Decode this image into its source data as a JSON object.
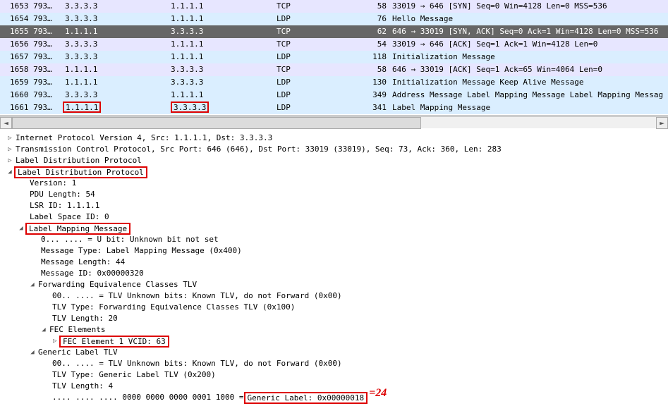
{
  "packets": [
    {
      "no": "1653",
      "time": "793…",
      "src": "3.3.3.3",
      "dst": "1.1.1.1",
      "proto": "TCP",
      "len": "58",
      "info": "33019 → 646 [SYN] Seq=0 Win=4128 Len=0 MSS=536",
      "cls": "tcp"
    },
    {
      "no": "1654",
      "time": "793…",
      "src": "3.3.3.3",
      "dst": "1.1.1.1",
      "proto": "LDP",
      "len": "76",
      "info": "Hello Message",
      "cls": "ldp"
    },
    {
      "no": "1655",
      "time": "793…",
      "src": "1.1.1.1",
      "dst": "3.3.3.3",
      "proto": "TCP",
      "len": "62",
      "info": "646 → 33019 [SYN, ACK] Seq=0 Ack=1 Win=4128 Len=0 MSS=536",
      "cls": "selected"
    },
    {
      "no": "1656",
      "time": "793…",
      "src": "3.3.3.3",
      "dst": "1.1.1.1",
      "proto": "TCP",
      "len": "54",
      "info": "33019 → 646 [ACK] Seq=1 Ack=1 Win=4128 Len=0",
      "cls": "tcp"
    },
    {
      "no": "1657",
      "time": "793…",
      "src": "3.3.3.3",
      "dst": "1.1.1.1",
      "proto": "LDP",
      "len": "118",
      "info": "Initialization Message",
      "cls": "ldp"
    },
    {
      "no": "1658",
      "time": "793…",
      "src": "1.1.1.1",
      "dst": "3.3.3.3",
      "proto": "TCP",
      "len": "58",
      "info": "646 → 33019 [ACK] Seq=1 Ack=65 Win=4064 Len=0",
      "cls": "tcp"
    },
    {
      "no": "1659",
      "time": "793…",
      "src": "1.1.1.1",
      "dst": "3.3.3.3",
      "proto": "LDP",
      "len": "130",
      "info": "Initialization Message Keep Alive Message",
      "cls": "ldp"
    },
    {
      "no": "1660",
      "time": "793…",
      "src": "3.3.3.3",
      "dst": "1.1.1.1",
      "proto": "LDP",
      "len": "349",
      "info": "Address Message Label Mapping Message Label Mapping Messag",
      "cls": "ldp"
    },
    {
      "no": "1661",
      "time": "793…",
      "src": "1.1.1.1",
      "dst": "3.3.3.3",
      "proto": "LDP",
      "len": "341",
      "info": "Label Mapping Message",
      "cls": "ldp",
      "hl_addr": true
    }
  ],
  "details": {
    "ip": "Internet Protocol Version 4, Src: 1.1.1.1, Dst: 3.3.3.3",
    "tcp": "Transmission Control Protocol, Src Port: 646 (646), Dst Port: 33019 (33019), Seq: 73, Ack: 360, Len: 283",
    "ldp1": "Label Distribution Protocol",
    "ldp2": "Label Distribution Protocol",
    "version": "Version: 1",
    "pdu_len": "PDU Length: 54",
    "lsr_id": "LSR ID: 1.1.1.1",
    "label_space": "Label Space ID: 0",
    "lmm": "Label Mapping Message",
    "ubit": "0... .... = U bit: Unknown bit not set",
    "msg_type": "Message Type: Label Mapping Message (0x400)",
    "msg_len": "Message Length: 44",
    "msg_id": "Message ID: 0x00000320",
    "fec_tlv": "Forwarding Equivalence Classes TLV",
    "fec_unknown": "00.. .... = TLV Unknown bits: Known TLV, do not Forward (0x00)",
    "fec_type": "TLV Type: Forwarding Equivalence Classes TLV (0x100)",
    "fec_len": "TLV Length: 20",
    "fec_elems": "FEC Elements",
    "fec_elem1": "FEC Element 1 VCID: 63",
    "gen_tlv": "Generic Label TLV",
    "gen_unknown": "00.. .... = TLV Unknown bits: Known TLV, do not Forward (0x00)",
    "gen_type": "TLV Type: Generic Label TLV (0x200)",
    "gen_len": "TLV Length: 4",
    "gen_bits_prefix": ".... .... .... 0000 0000 0000 0001 1000 = ",
    "gen_label": "Generic Label: 0x00000018",
    "annot": "=24"
  },
  "scrollbar_glyphs": {
    "left": "◄",
    "right": "►"
  }
}
